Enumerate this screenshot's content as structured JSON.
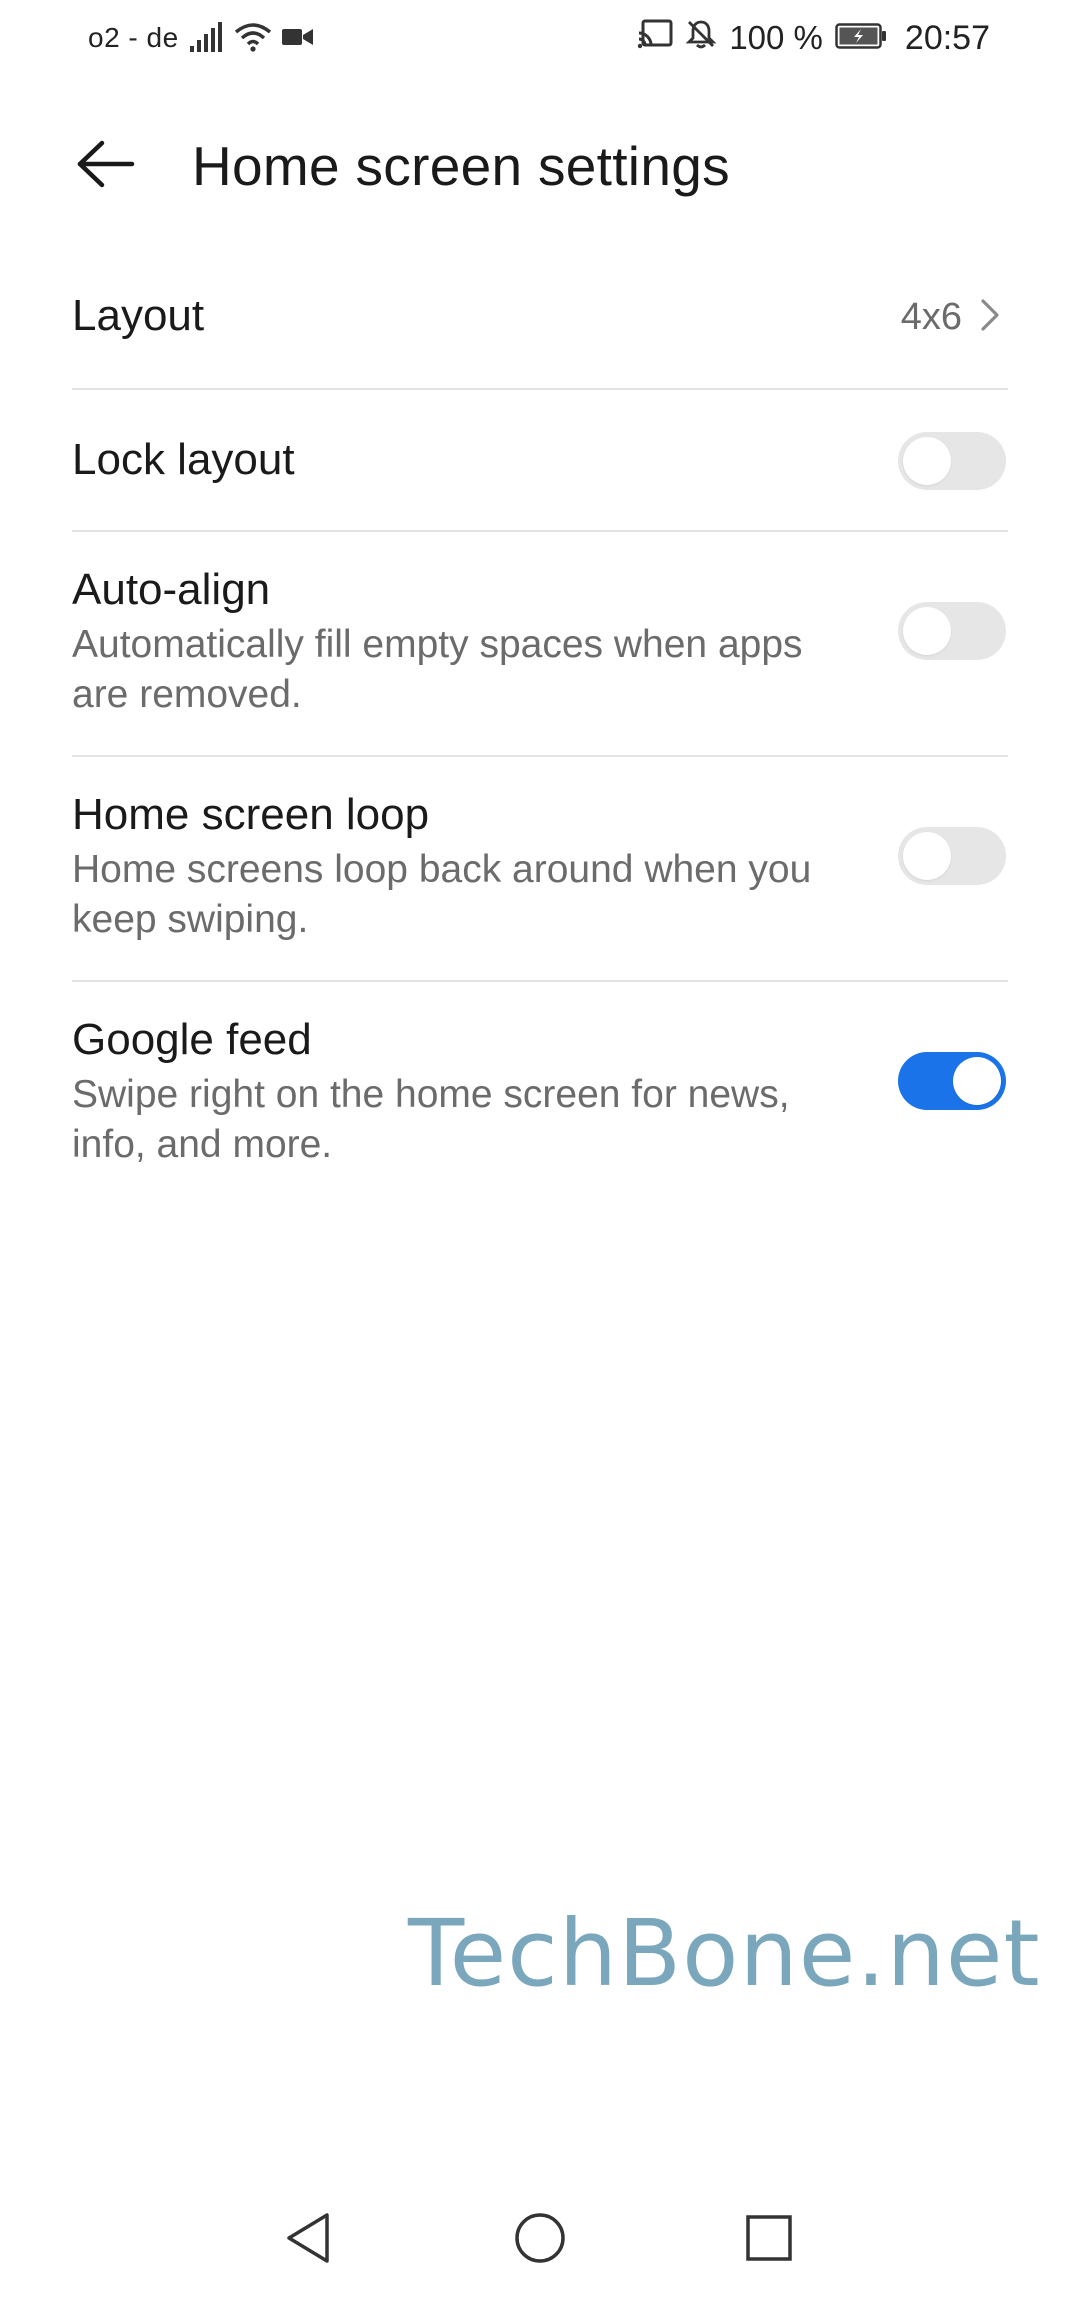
{
  "status_bar": {
    "carrier": "o2 - de",
    "battery_percent": "100 %",
    "time": "20:57",
    "icons": [
      "signal-icon",
      "wifi-icon",
      "video-camera-icon",
      "cast-icon",
      "notifications-off-icon",
      "battery-charging-icon"
    ]
  },
  "header": {
    "back_icon": "back-arrow-icon",
    "title": "Home screen settings"
  },
  "settings": {
    "layout": {
      "title": "Layout",
      "value": "4x6",
      "chevron_icon": "chevron-right-icon"
    },
    "lock_layout": {
      "title": "Lock layout",
      "enabled": false
    },
    "auto_align": {
      "title": "Auto-align",
      "description": "Automatically fill empty spaces when apps are removed.",
      "enabled": false
    },
    "home_screen_loop": {
      "title": "Home screen loop",
      "description": "Home screens loop back around when you keep swiping.",
      "enabled": false
    },
    "google_feed": {
      "title": "Google feed",
      "description": "Swipe right on the home screen for news, info, and more.",
      "enabled": true
    }
  },
  "watermark": "TechBone.net",
  "colors": {
    "accent": "#1a73e8",
    "toggle_off": "#e6e6e6",
    "watermark": "#7ba7bd",
    "divider": "#e3e3e3",
    "secondary_text": "#6b6b6b"
  },
  "nav_bar": {
    "icons": [
      "nav-back-icon",
      "nav-home-icon",
      "nav-recents-icon"
    ]
  }
}
